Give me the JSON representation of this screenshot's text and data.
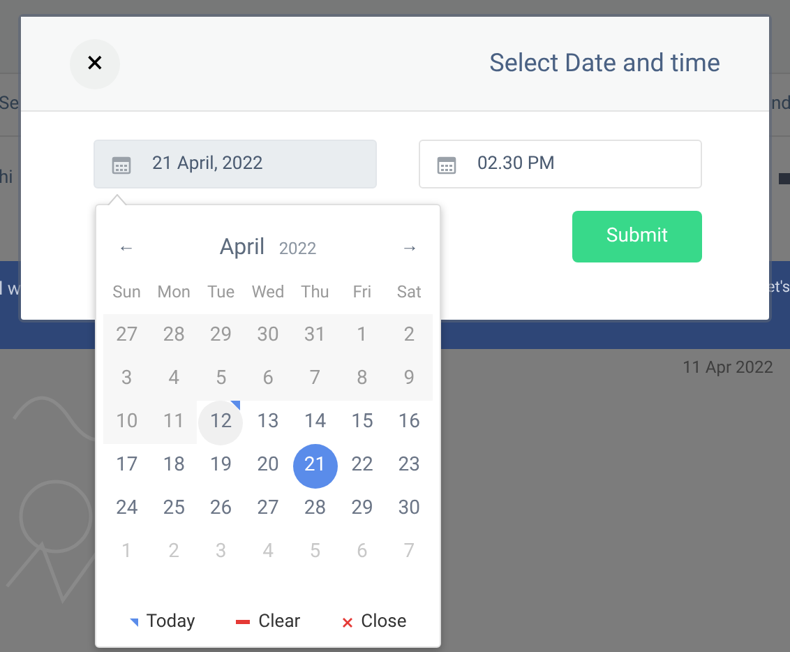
{
  "background": {
    "fragments": {
      "row_1_left": "Se",
      "row_1_right": "nd",
      "row_2_left": "hi",
      "banner_left": "l w",
      "banner_right": "et's"
    },
    "date_label": "11 Apr 2022"
  },
  "dialog": {
    "close_label": "×",
    "title": "Select Date and time",
    "date_field": {
      "value": "21 April, 2022",
      "focused": true
    },
    "time_field": {
      "value": "02.30 PM",
      "focused": false
    },
    "submit_label": "Submit"
  },
  "calendar": {
    "prev": "←",
    "next": "→",
    "month": "April",
    "year": "2022",
    "weekdays": [
      "Sun",
      "Mon",
      "Tue",
      "Wed",
      "Thu",
      "Fri",
      "Sat"
    ],
    "weeks": [
      [
        {
          "label": "27",
          "kind": "disabled",
          "selected": false,
          "today": false
        },
        {
          "label": "28",
          "kind": "disabled",
          "selected": false,
          "today": false
        },
        {
          "label": "29",
          "kind": "disabled",
          "selected": false,
          "today": false
        },
        {
          "label": "30",
          "kind": "disabled",
          "selected": false,
          "today": false
        },
        {
          "label": "31",
          "kind": "disabled",
          "selected": false,
          "today": false
        },
        {
          "label": "1",
          "kind": "disabled",
          "selected": false,
          "today": false
        },
        {
          "label": "2",
          "kind": "disabled",
          "selected": false,
          "today": false
        }
      ],
      [
        {
          "label": "3",
          "kind": "disabled",
          "selected": false,
          "today": false
        },
        {
          "label": "4",
          "kind": "disabled",
          "selected": false,
          "today": false
        },
        {
          "label": "5",
          "kind": "disabled",
          "selected": false,
          "today": false
        },
        {
          "label": "6",
          "kind": "disabled",
          "selected": false,
          "today": false
        },
        {
          "label": "7",
          "kind": "disabled",
          "selected": false,
          "today": false
        },
        {
          "label": "8",
          "kind": "disabled",
          "selected": false,
          "today": false
        },
        {
          "label": "9",
          "kind": "disabled",
          "selected": false,
          "today": false
        }
      ],
      [
        {
          "label": "10",
          "kind": "disabled",
          "selected": false,
          "today": false
        },
        {
          "label": "11",
          "kind": "disabled",
          "selected": false,
          "today": false
        },
        {
          "label": "12",
          "kind": "normal",
          "selected": false,
          "today": true
        },
        {
          "label": "13",
          "kind": "normal",
          "selected": false,
          "today": false
        },
        {
          "label": "14",
          "kind": "normal",
          "selected": false,
          "today": false
        },
        {
          "label": "15",
          "kind": "normal",
          "selected": false,
          "today": false
        },
        {
          "label": "16",
          "kind": "normal",
          "selected": false,
          "today": false
        }
      ],
      [
        {
          "label": "17",
          "kind": "normal",
          "selected": false,
          "today": false
        },
        {
          "label": "18",
          "kind": "normal",
          "selected": false,
          "today": false
        },
        {
          "label": "19",
          "kind": "normal",
          "selected": false,
          "today": false
        },
        {
          "label": "20",
          "kind": "normal",
          "selected": false,
          "today": false
        },
        {
          "label": "21",
          "kind": "normal",
          "selected": true,
          "today": false
        },
        {
          "label": "22",
          "kind": "normal",
          "selected": false,
          "today": false
        },
        {
          "label": "23",
          "kind": "normal",
          "selected": false,
          "today": false
        }
      ],
      [
        {
          "label": "24",
          "kind": "normal",
          "selected": false,
          "today": false
        },
        {
          "label": "25",
          "kind": "normal",
          "selected": false,
          "today": false
        },
        {
          "label": "26",
          "kind": "normal",
          "selected": false,
          "today": false
        },
        {
          "label": "27",
          "kind": "normal",
          "selected": false,
          "today": false
        },
        {
          "label": "28",
          "kind": "normal",
          "selected": false,
          "today": false
        },
        {
          "label": "29",
          "kind": "normal",
          "selected": false,
          "today": false
        },
        {
          "label": "30",
          "kind": "normal",
          "selected": false,
          "today": false
        }
      ],
      [
        {
          "label": "1",
          "kind": "other_month",
          "selected": false,
          "today": false
        },
        {
          "label": "2",
          "kind": "other_month",
          "selected": false,
          "today": false
        },
        {
          "label": "3",
          "kind": "other_month",
          "selected": false,
          "today": false
        },
        {
          "label": "4",
          "kind": "other_month",
          "selected": false,
          "today": false
        },
        {
          "label": "5",
          "kind": "other_month",
          "selected": false,
          "today": false
        },
        {
          "label": "6",
          "kind": "other_month",
          "selected": false,
          "today": false
        },
        {
          "label": "7",
          "kind": "other_month",
          "selected": false,
          "today": false
        }
      ]
    ],
    "footer": [
      {
        "kind": "today",
        "label": "Today"
      },
      {
        "kind": "clear",
        "label": "Clear"
      },
      {
        "kind": "close",
        "label": "Close"
      }
    ]
  }
}
